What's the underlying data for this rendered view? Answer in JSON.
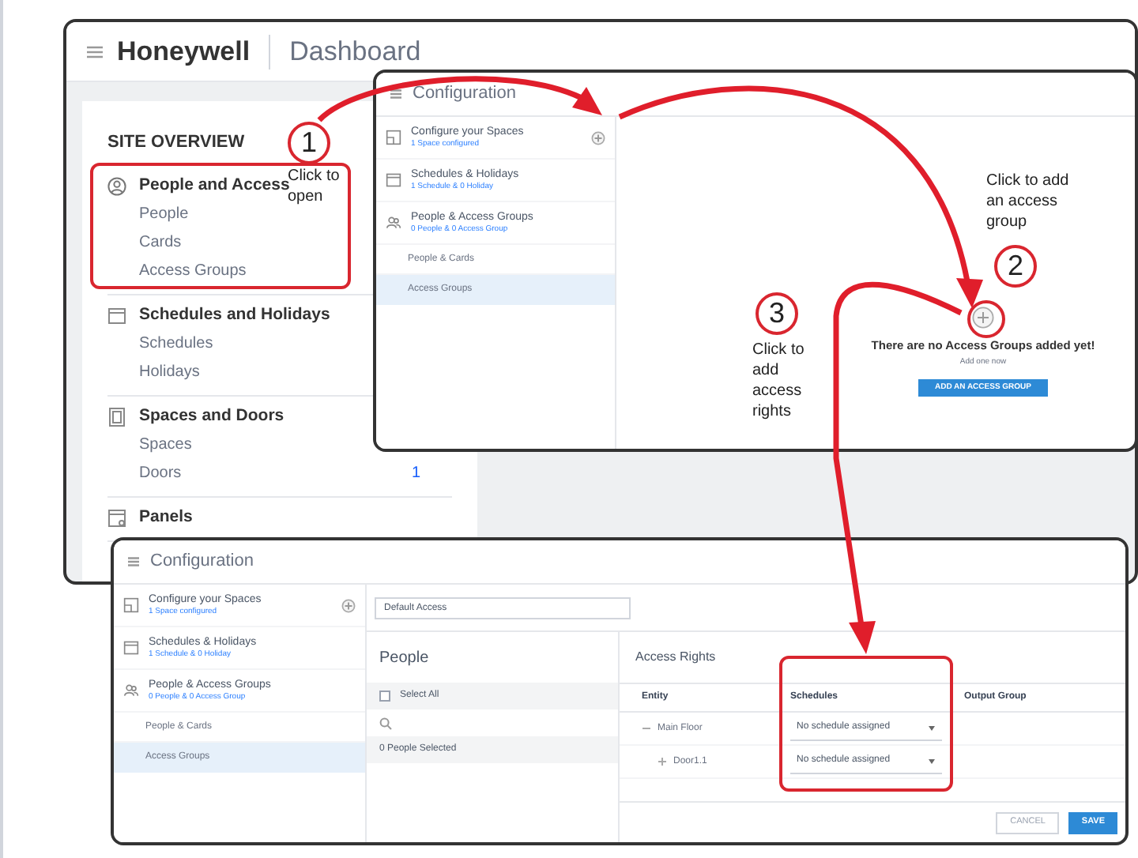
{
  "dashboard": {
    "brand": "Honeywell",
    "title": "Dashboard",
    "heading": "SITE OVERVIEW",
    "sections": [
      {
        "kind": "person",
        "title": "People and Access",
        "items": [
          {
            "label": "People"
          },
          {
            "label": "Cards"
          },
          {
            "label": "Access Groups"
          }
        ]
      },
      {
        "kind": "calendar",
        "title": "Schedules and Holidays",
        "items": [
          {
            "label": "Schedules"
          },
          {
            "label": "Holidays"
          }
        ]
      },
      {
        "kind": "door",
        "title": "Spaces and Doors",
        "items": [
          {
            "label": "Spaces"
          },
          {
            "label": "Doors",
            "count": "1"
          }
        ]
      },
      {
        "kind": "panel",
        "title": "Panels"
      }
    ]
  },
  "config_window": {
    "title": "Configuration",
    "nav": [
      {
        "kind": "space",
        "title": "Configure your Spaces",
        "subtitle": "1 Space configured"
      },
      {
        "kind": "calendar",
        "title": "Schedules & Holidays",
        "subtitle": "1 Schedule & 0 Holiday"
      },
      {
        "kind": "people",
        "title": "People & Access Groups",
        "subtitle": "0 People & 0 Access Group"
      }
    ],
    "subnav": [
      {
        "label": "People & Cards",
        "selected": false
      },
      {
        "label": "Access Groups",
        "selected": true
      }
    ],
    "empty_state": {
      "message": "There are no Access Groups added yet!",
      "hint": "Add one now",
      "button": "ADD AN ACCESS GROUP"
    }
  },
  "access_group_window": {
    "title": "Configuration",
    "nav": [
      {
        "kind": "space",
        "title": "Configure your Spaces",
        "subtitle": "1 Space configured"
      },
      {
        "kind": "calendar",
        "title": "Schedules & Holidays",
        "subtitle": "1 Schedule & 0 Holiday"
      },
      {
        "kind": "people",
        "title": "People & Access Groups",
        "subtitle": "0 People & 0 Access Group"
      }
    ],
    "subnav": [
      {
        "label": "People & Cards",
        "selected": false
      },
      {
        "label": "Access Groups",
        "selected": true
      }
    ],
    "name_field": {
      "value": "Default Access"
    },
    "people": {
      "heading": "People",
      "select_all": {
        "label": "Select All",
        "checked": false
      },
      "selected_count": "0 People Selected"
    },
    "access_rights": {
      "heading": "Access Rights",
      "columns": [
        "Entity",
        "Schedules",
        "Output Group"
      ],
      "rows": [
        {
          "entity": "Main Floor",
          "expanded": true,
          "schedule": "No schedule assigned",
          "children": [
            {
              "entity": "Door1.1",
              "expanded": false,
              "schedule": "No schedule assigned"
            }
          ]
        }
      ]
    },
    "buttons": [
      {
        "label": "CANCEL",
        "kind": "secondary"
      },
      {
        "label": "SAVE",
        "kind": "primary"
      }
    ]
  },
  "annotations": [
    {
      "number": "1",
      "text": "Click to open"
    },
    {
      "number": "2",
      "text": "Click to add an access group"
    },
    {
      "number": "3",
      "text": "Click to add access rights"
    }
  ]
}
